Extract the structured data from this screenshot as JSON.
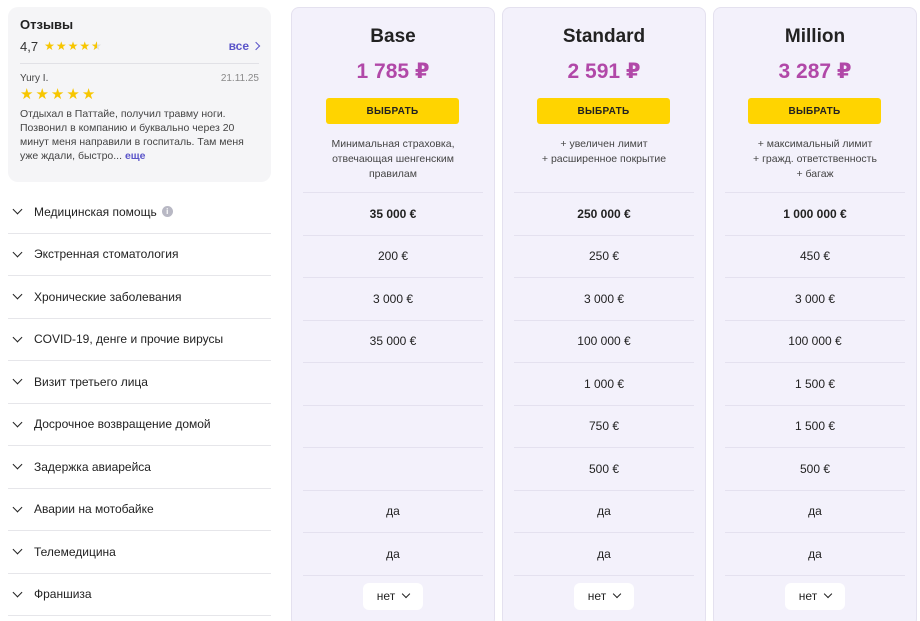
{
  "reviews": {
    "title": "Отзывы",
    "score": "4,7",
    "all_label": "все",
    "review": {
      "author": "Yury I.",
      "date": "21.11.25",
      "text": "Отдыхал в Паттайе, получил травму ноги. Позвонил в компанию и буквально через 20 минут меня направили в госпиталь. Там меня уже ждали, быстро...",
      "more_label": "еще"
    }
  },
  "features": [
    {
      "label": "Медицинская помощь",
      "info": true
    },
    {
      "label": "Экстренная стоматология"
    },
    {
      "label": "Хронические заболевания"
    },
    {
      "label": "COVID-19, денге и прочие вирусы"
    },
    {
      "label": "Визит третьего лица"
    },
    {
      "label": "Досрочное возвращение домой"
    },
    {
      "label": "Задержка авиарейса"
    },
    {
      "label": "Аварии на мотобайке"
    },
    {
      "label": "Телемедицина"
    },
    {
      "label": "Франшиза"
    }
  ],
  "plans": [
    {
      "name": "Base",
      "price": "1 785 ₽",
      "button": "ВЫБРАТЬ",
      "desc": [
        "Минимальная страховка,",
        "отвечающая шенгенским",
        "правилам"
      ],
      "values": [
        "35 000 €",
        "200 €",
        "3 000 €",
        "35 000 €",
        "",
        "",
        "",
        "да",
        "да"
      ],
      "franchise": "нет"
    },
    {
      "name": "Standard",
      "price": "2 591 ₽",
      "button": "ВЫБРАТЬ",
      "desc": [
        "+ увеличен лимит",
        "+ расширенное покрытие"
      ],
      "values": [
        "250 000 €",
        "250 €",
        "3 000 €",
        "100 000 €",
        "1 000 €",
        "750 €",
        "500 €",
        "да",
        "да"
      ],
      "franchise": "нет"
    },
    {
      "name": "Million",
      "price": "3 287 ₽",
      "button": "ВЫБРАТЬ",
      "desc": [
        "+ максимальный лимит",
        "+ гражд. ответственность",
        "+ багаж"
      ],
      "values": [
        "1 000 000 €",
        "450 €",
        "3 000 €",
        "100 000 €",
        "1 500 €",
        "1 500 €",
        "500 €",
        "да",
        "да"
      ],
      "franchise": "нет"
    }
  ]
}
